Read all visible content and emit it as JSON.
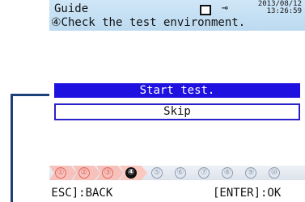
{
  "header": {
    "title": "Guide",
    "subtitle": "④Check the test environment.",
    "date": "2013/08/12",
    "time": "13:26:59",
    "battery_icon": "battery-icon",
    "power_icon": "power-plug-icon"
  },
  "buttons": {
    "start": "Start test.",
    "skip": "Skip"
  },
  "steps": [
    {
      "label": "①",
      "state": "done"
    },
    {
      "label": "②",
      "state": "done"
    },
    {
      "label": "③",
      "state": "done"
    },
    {
      "label": "④",
      "state": "current"
    },
    {
      "label": "⑤",
      "state": "todo"
    },
    {
      "label": "⑥",
      "state": "todo"
    },
    {
      "label": "⑦",
      "state": "todo"
    },
    {
      "label": "⑧",
      "state": "todo"
    },
    {
      "label": "⑨",
      "state": "todo"
    },
    {
      "label": "⑩",
      "state": "todo"
    }
  ],
  "footer": {
    "back": "[ESC]:BACK",
    "ok": "[ENTER]:OK"
  },
  "colors": {
    "accent": "#1f12e0",
    "header_bg": "#c5dff3",
    "step_done": "#de6b5f",
    "step_todo": "#8c9bb0",
    "leader_line": "#1d3f7c"
  }
}
